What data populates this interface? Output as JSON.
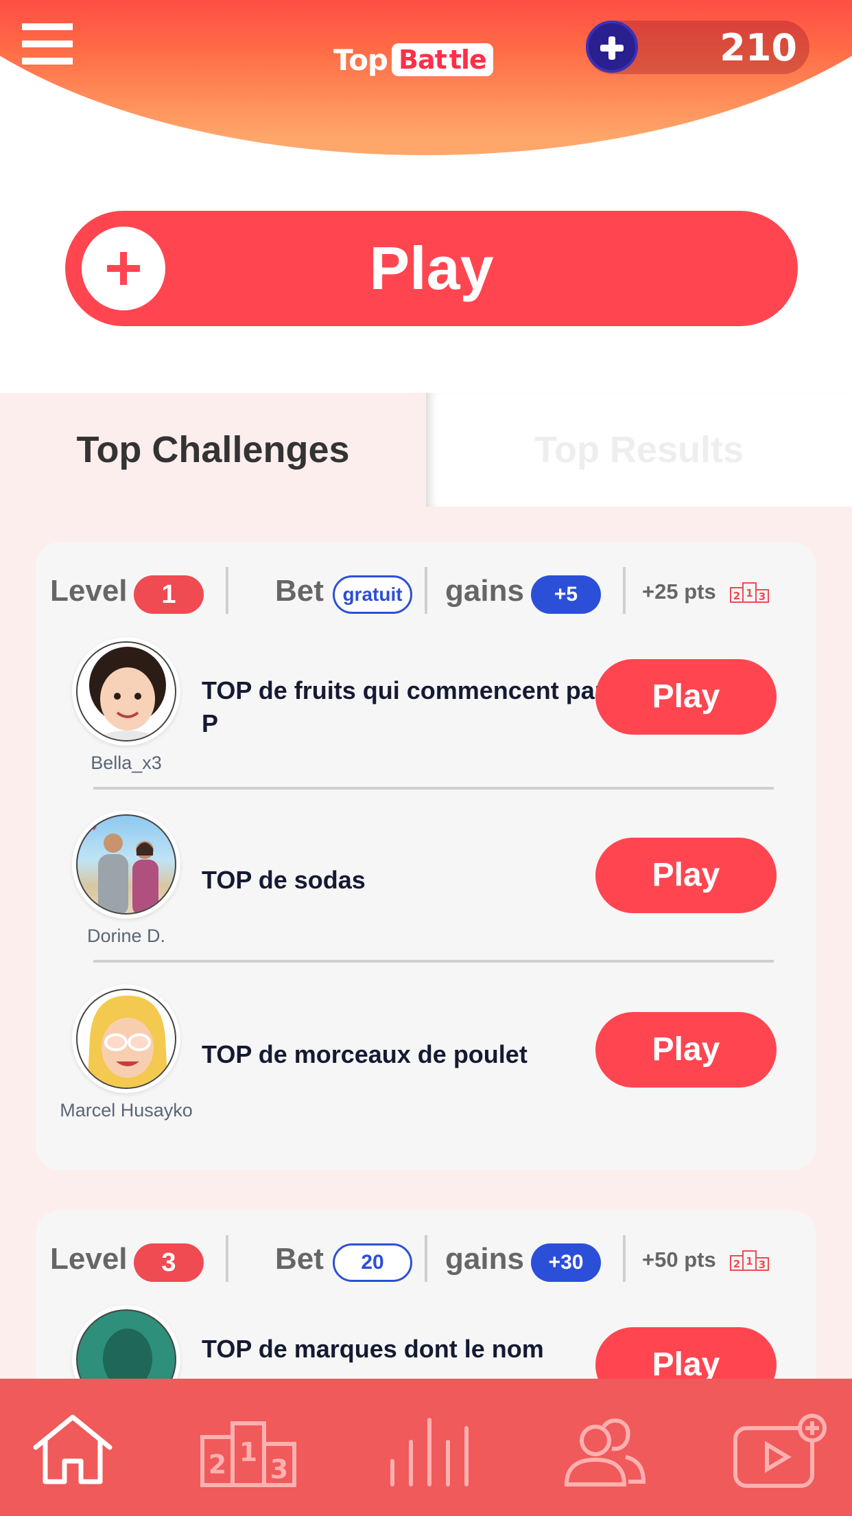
{
  "header": {
    "logo_top": "Top",
    "logo_bat": "Bat",
    "logo_tle": "tle",
    "coins": "210"
  },
  "main_play": {
    "label": "Play"
  },
  "tabs": [
    {
      "label": "Top Challenges",
      "active": true
    },
    {
      "label": "Top Results",
      "active": false
    }
  ],
  "cards": [
    {
      "level_label": "Level",
      "level": "1",
      "bet_label": "Bet",
      "bet": "gratuit",
      "gains_label": "gains",
      "gains": "+5",
      "points": "+25 pts",
      "challenges": [
        {
          "author": "Bella_x3",
          "title": "TOP de fruits qui commencent par P",
          "play": "Play"
        },
        {
          "author": "Dorine D.",
          "title": "TOP de sodas",
          "play": "Play"
        },
        {
          "author": "Marcel Husayko",
          "title": "TOP de morceaux de poulet",
          "play": "Play"
        }
      ]
    },
    {
      "level_label": "Level",
      "level": "3",
      "bet_label": "Bet",
      "bet": "20",
      "gains_label": "gains",
      "gains": "+30",
      "points": "+50 pts",
      "challenges": [
        {
          "author": "",
          "title": "TOP de marques dont le nom",
          "play": "Play"
        }
      ]
    }
  ],
  "podium_digits": [
    "2",
    "1",
    "3"
  ],
  "bottom_nav": [
    {
      "icon": "home-icon",
      "active": true
    },
    {
      "icon": "podium-icon",
      "active": false
    },
    {
      "icon": "stats-icon",
      "active": false
    },
    {
      "icon": "friends-icon",
      "active": false
    },
    {
      "icon": "video-add-icon",
      "active": false
    }
  ],
  "colors": {
    "accent": "#ff4650",
    "blue": "#2c4fd8",
    "nav_bg": "#f05a5a",
    "page_bg": "#fbeeed"
  }
}
